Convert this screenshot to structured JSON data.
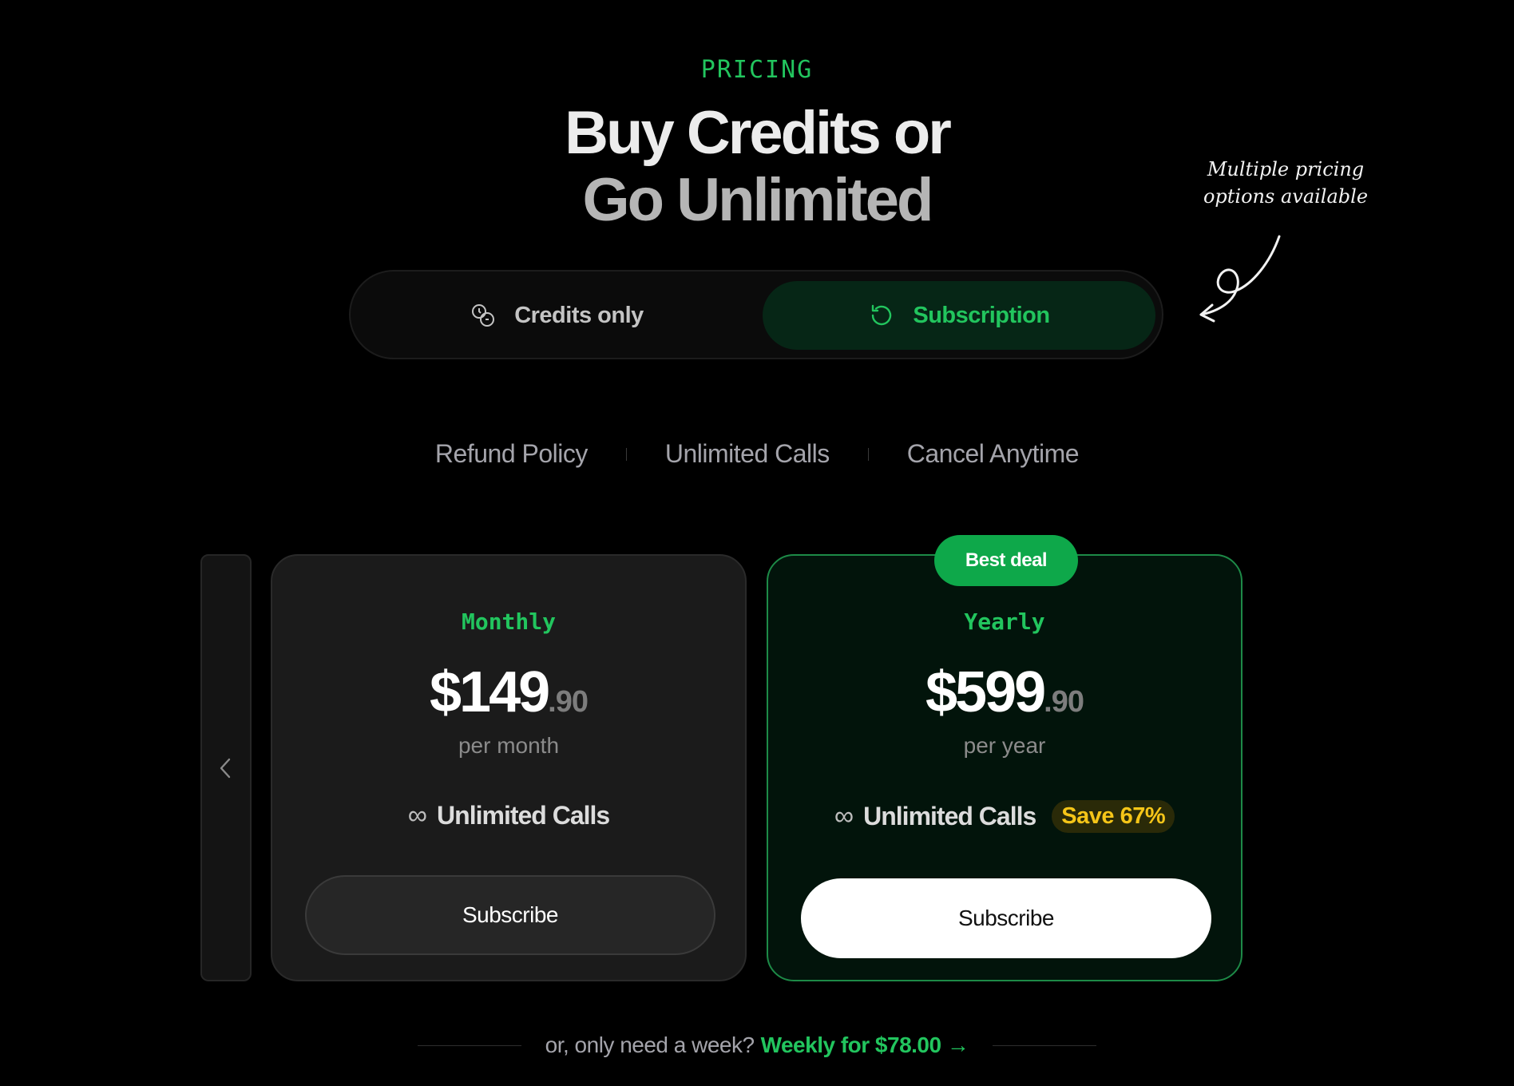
{
  "header": {
    "eyebrow": "PRICING",
    "title_line1": "Buy Credits or",
    "title_line2": "Go Unlimited"
  },
  "annotation": {
    "line1": "Multiple pricing",
    "line2": "options available",
    "icon": "curly-arrow-icon"
  },
  "toggle": {
    "options": [
      {
        "label": "Credits only",
        "icon": "coins-icon",
        "selected": false
      },
      {
        "label": "Subscription",
        "icon": "refresh-icon",
        "selected": true
      }
    ]
  },
  "features": [
    "Refund Policy",
    "Unlimited Calls",
    "Cancel Anytime"
  ],
  "plans": [
    {
      "name": "Monthly",
      "price_main": "$149",
      "price_cents": ".90",
      "period": "per month",
      "feature": "Unlimited Calls",
      "feature_icon": "infinity-icon",
      "button": "Subscribe"
    },
    {
      "name": "Yearly",
      "badge": "Best deal",
      "price_main": "$599",
      "price_cents": ".90",
      "period": "per year",
      "feature": "Unlimited Calls",
      "feature_icon": "infinity-icon",
      "save": "Save 67%",
      "button": "Subscribe"
    }
  ],
  "weekly": {
    "question": "or, only need a week?",
    "link": "Weekly for $78.00 →"
  },
  "colors": {
    "background": "#000000",
    "accent": "#22c55e",
    "badge": "#0ea84a",
    "save": "#f5c518"
  }
}
